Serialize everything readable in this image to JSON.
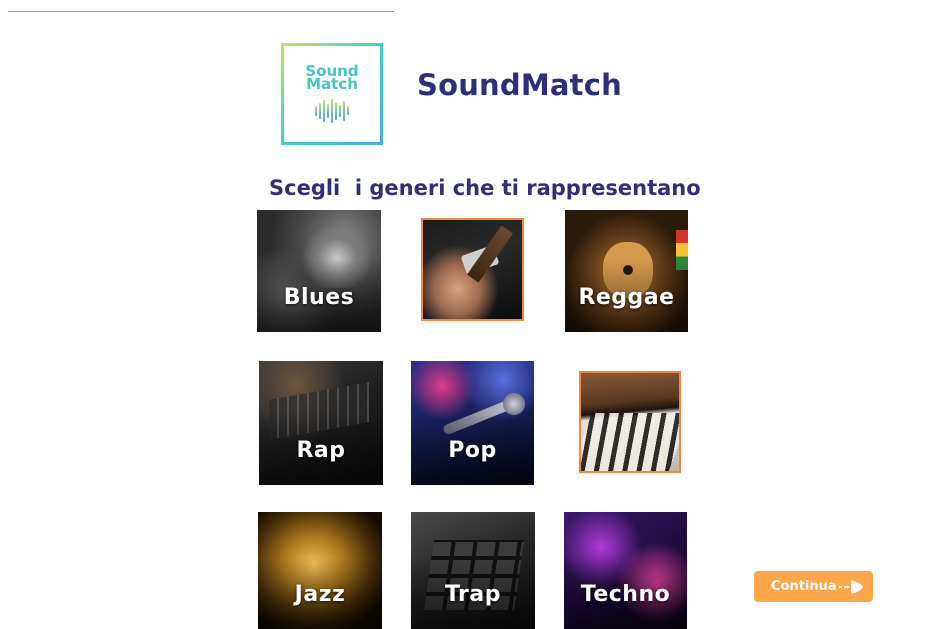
{
  "app": {
    "title": "SoundMatch",
    "logo_lines": [
      "Sound",
      "Match"
    ]
  },
  "headline": "Scegli  i generi che ti rappresentano",
  "genres": [
    {
      "label": "Blues",
      "selected": false,
      "image": "resonator-guitar-photo"
    },
    {
      "label": "",
      "selected": true,
      "image": "electric-guitar-photo"
    },
    {
      "label": "Reggae",
      "selected": false,
      "image": "acoustic-guitar-drum-photo"
    },
    {
      "label": "Rap",
      "selected": false,
      "image": "dj-mixer-photo"
    },
    {
      "label": "Pop",
      "selected": false,
      "image": "microphone-photo"
    },
    {
      "label": "",
      "selected": true,
      "image": "piano-keys-photo"
    },
    {
      "label": "Jazz",
      "selected": false,
      "image": "saxophone-photo"
    },
    {
      "label": "Trap",
      "selected": false,
      "image": "drum-pad-controller-photo"
    },
    {
      "label": "Techno",
      "selected": false,
      "image": "dj-deck-photo"
    }
  ],
  "continue_button": {
    "label": "Continua",
    "icon": "arrow-right-icon"
  },
  "colors": {
    "accent": "#ffa54a",
    "title": "#2d2f7a",
    "selected_border": "#f5883c"
  }
}
